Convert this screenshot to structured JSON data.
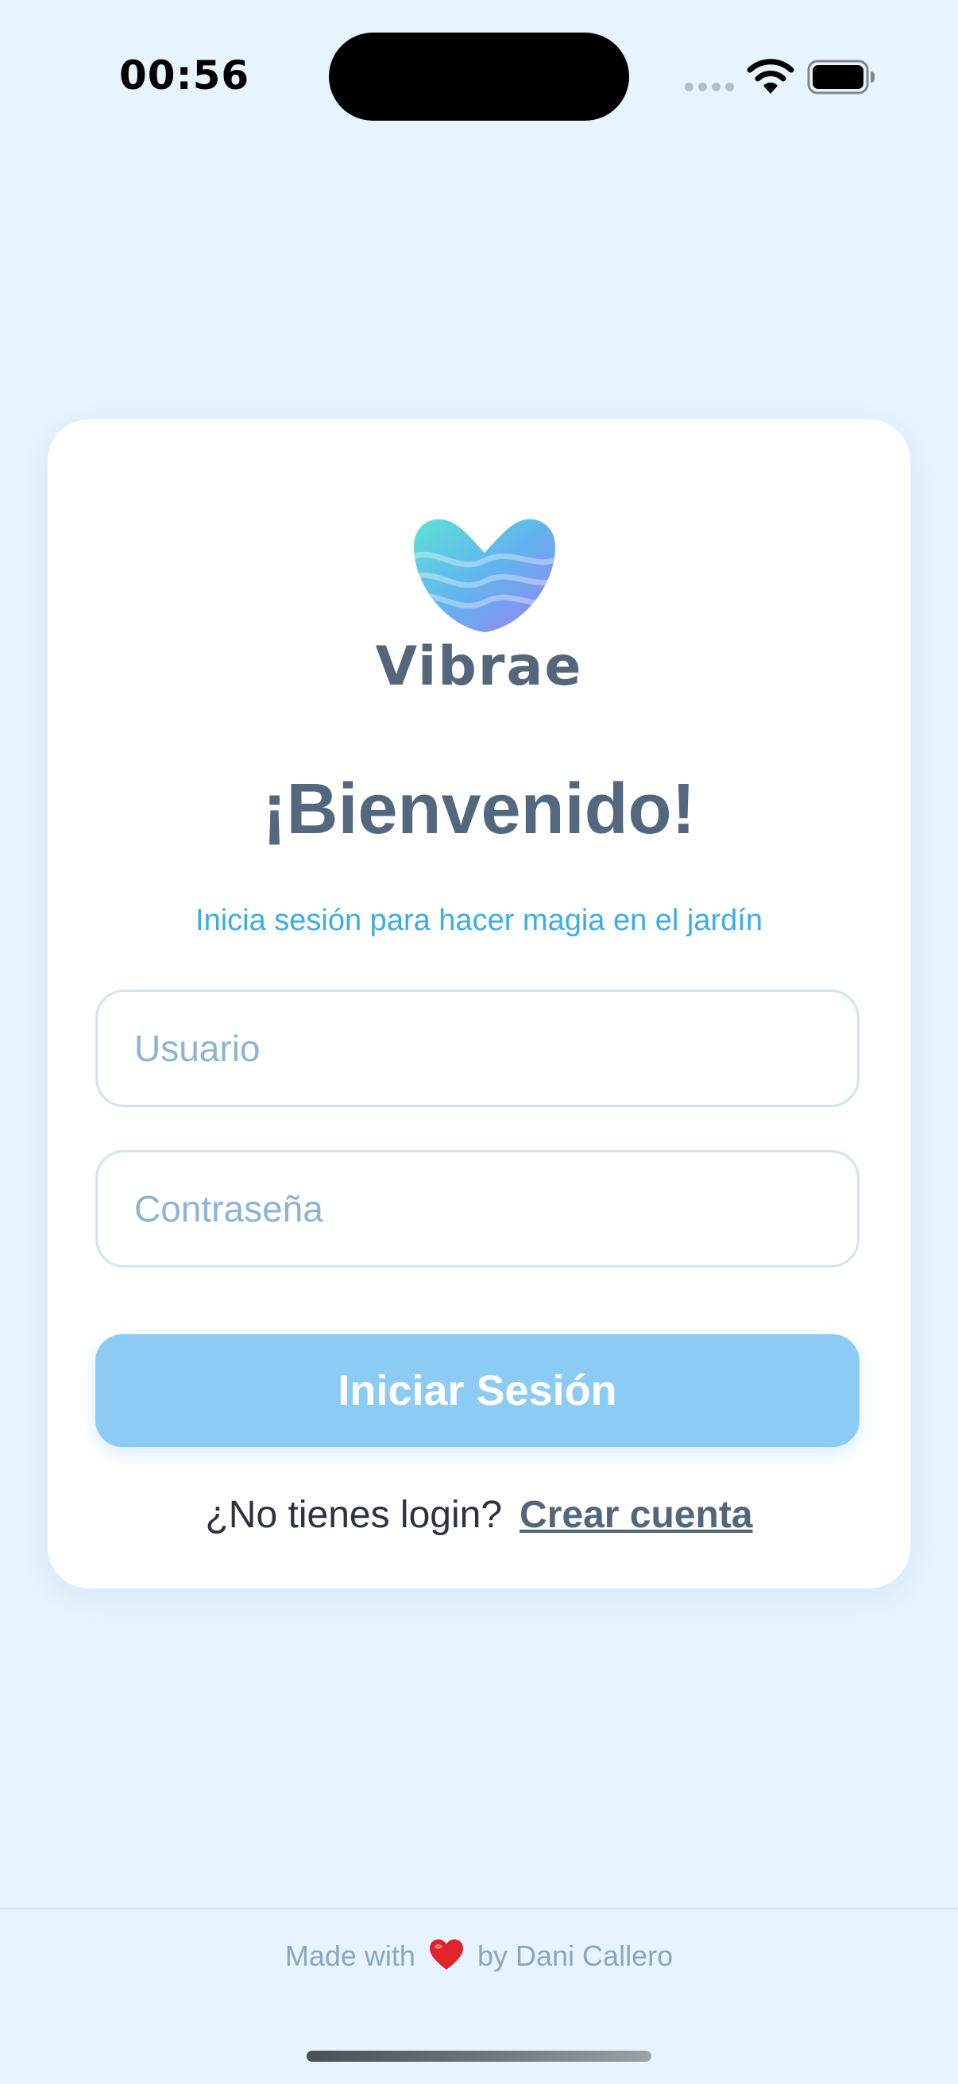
{
  "status_bar": {
    "time": "00:56"
  },
  "app": {
    "name": "Vibrae"
  },
  "login": {
    "title": "¡Bienvenido!",
    "subtitle": "Inicia sesión para hacer magia en el jardín",
    "username_placeholder": "Usuario",
    "username_value": "",
    "password_placeholder": "Contraseña",
    "password_value": "",
    "submit_label": "Iniciar Sesión",
    "no_account_text": "¿No tienes login?",
    "create_account_label": "Crear cuenta"
  },
  "footer": {
    "made_with": "Made with",
    "by": "by Dani Callero"
  },
  "icons": {
    "logo": "wave-heart-logo",
    "heart": "red-heart-icon",
    "wifi": "wifi-icon",
    "battery": "battery-icon",
    "signal": "cellular-signal-icon"
  },
  "colors": {
    "background": "#e8f4fd",
    "card": "#ffffff",
    "title": "#53687f",
    "subtitle": "#3aaee3",
    "button": "#8cccf4",
    "input_border": "#cfe5f5",
    "placeholder": "#8fb3d6",
    "footer_text": "#8ba5c2",
    "heart": "#e0242c"
  }
}
